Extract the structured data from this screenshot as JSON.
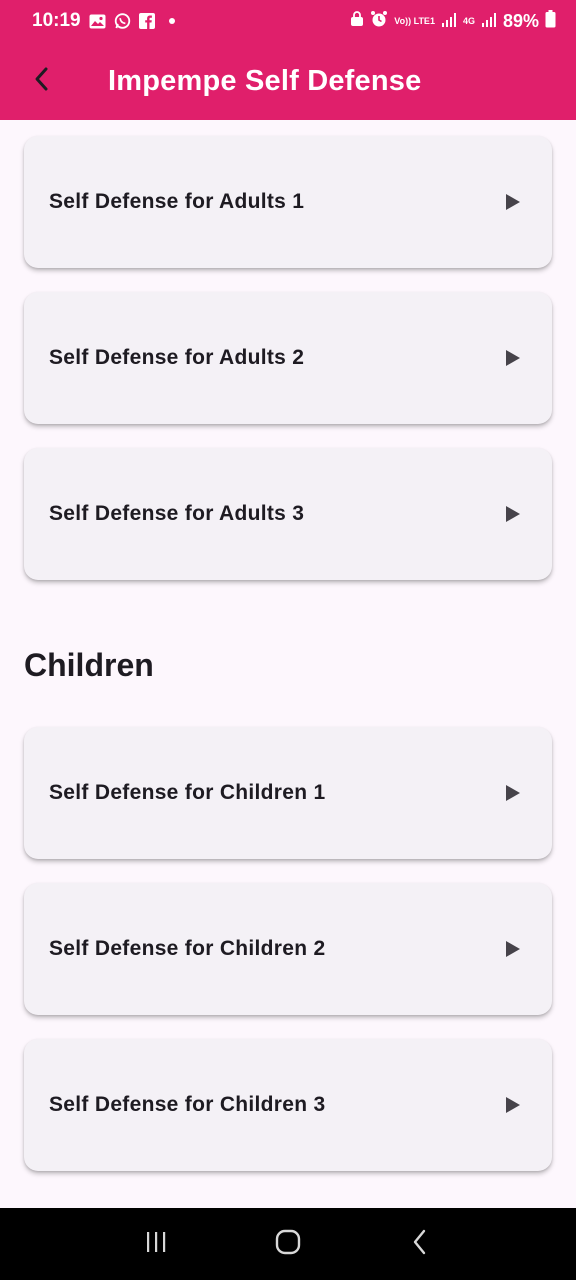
{
  "status_bar": {
    "time": "10:19",
    "battery": "89%",
    "network_labels": [
      "Vo)) LTE1",
      "4G"
    ],
    "icons": [
      "gallery-icon",
      "whatsapp-icon",
      "facebook-icon",
      "dot-icon",
      "lock-icon",
      "alarm-icon",
      "signal-icon",
      "battery-icon"
    ]
  },
  "app_bar": {
    "title": "Impempe Self Defense",
    "back_icon": "back-arrow-icon",
    "color": "#e01f6b"
  },
  "adults": {
    "items": [
      {
        "label": "Self Defense for Adults 1"
      },
      {
        "label": "Self Defense for Adults 2"
      },
      {
        "label": "Self Defense for Adults 3"
      }
    ]
  },
  "children": {
    "heading": "Children",
    "items": [
      {
        "label": "Self Defense for Children 1"
      },
      {
        "label": "Self Defense for Children 2"
      },
      {
        "label": "Self Defense for Children 3"
      }
    ]
  },
  "nav_bar": {
    "buttons": [
      "recent-apps-icon",
      "home-icon",
      "back-icon"
    ]
  }
}
